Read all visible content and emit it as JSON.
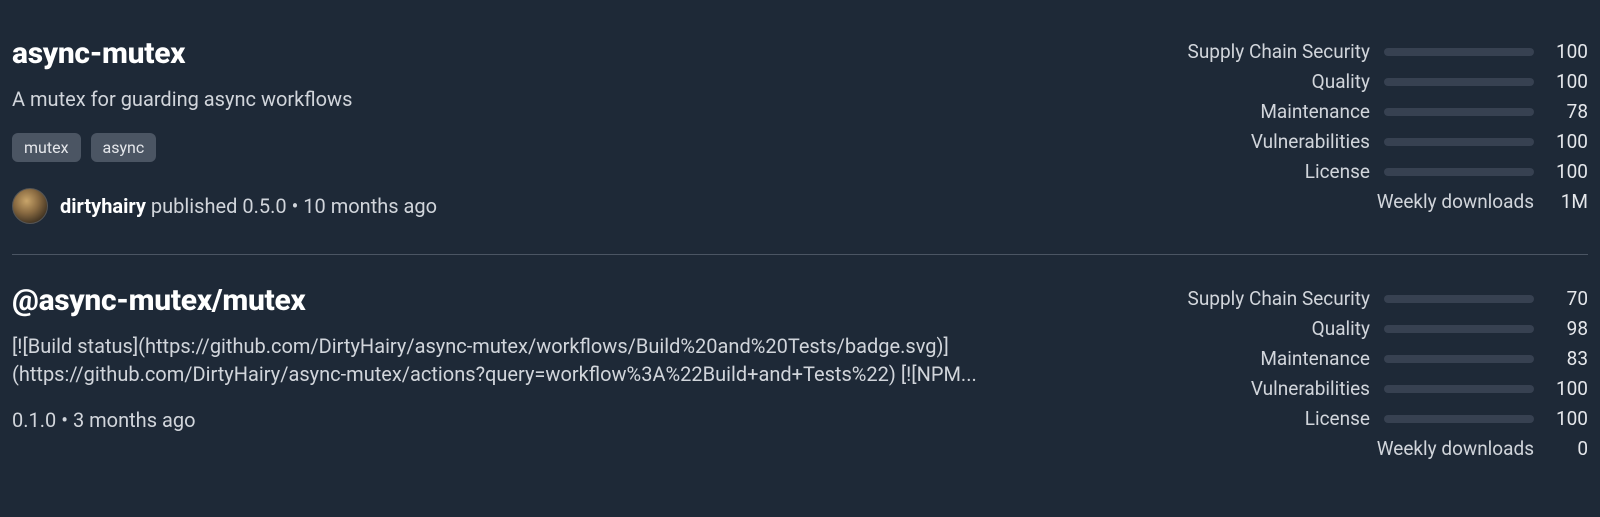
{
  "packages": [
    {
      "name": "async-mutex",
      "description": "A mutex for guarding async workflows",
      "tags": [
        "mutex",
        "async"
      ],
      "publisher": {
        "name": "dirtyhairy",
        "version": "0.5.0",
        "ago": "10 months ago",
        "prefix": " published ",
        "sep": " • "
      },
      "meta": null,
      "metrics": [
        {
          "label": "Supply Chain Security",
          "value": "100",
          "pct": 100,
          "color": "#6ac28a"
        },
        {
          "label": "Quality",
          "value": "100",
          "pct": 100,
          "color": "#6ac28a"
        },
        {
          "label": "Maintenance",
          "value": "78",
          "pct": 78,
          "color": "#e8a23f"
        },
        {
          "label": "Vulnerabilities",
          "value": "100",
          "pct": 100,
          "color": "#6ac28a"
        },
        {
          "label": "License",
          "value": "100",
          "pct": 100,
          "color": "#6ac28a"
        },
        {
          "label": "Weekly downloads",
          "value": "1M",
          "pct": null,
          "color": null
        }
      ]
    },
    {
      "name": "@async-mutex/mutex",
      "description": "[![Build status](https://github.com/DirtyHairy/async-mutex/workflows/Build%20and%20Tests/badge.svg)](https://github.com/DirtyHairy/async-mutex/actions?query=workflow%3A%22Build+and+Tests%22) [![NPM...",
      "tags": [],
      "publisher": null,
      "meta": "0.1.0 • 3 months ago",
      "metrics": [
        {
          "label": "Supply Chain Security",
          "value": "70",
          "pct": 70,
          "color": "#e8a23f"
        },
        {
          "label": "Quality",
          "value": "98",
          "pct": 98,
          "color": "#6ac28a"
        },
        {
          "label": "Maintenance",
          "value": "83",
          "pct": 83,
          "color": "#6ac28a"
        },
        {
          "label": "Vulnerabilities",
          "value": "100",
          "pct": 100,
          "color": "#6ac28a"
        },
        {
          "label": "License",
          "value": "100",
          "pct": 100,
          "color": "#6ac28a"
        },
        {
          "label": "Weekly downloads",
          "value": "0",
          "pct": null,
          "color": null
        }
      ]
    }
  ]
}
